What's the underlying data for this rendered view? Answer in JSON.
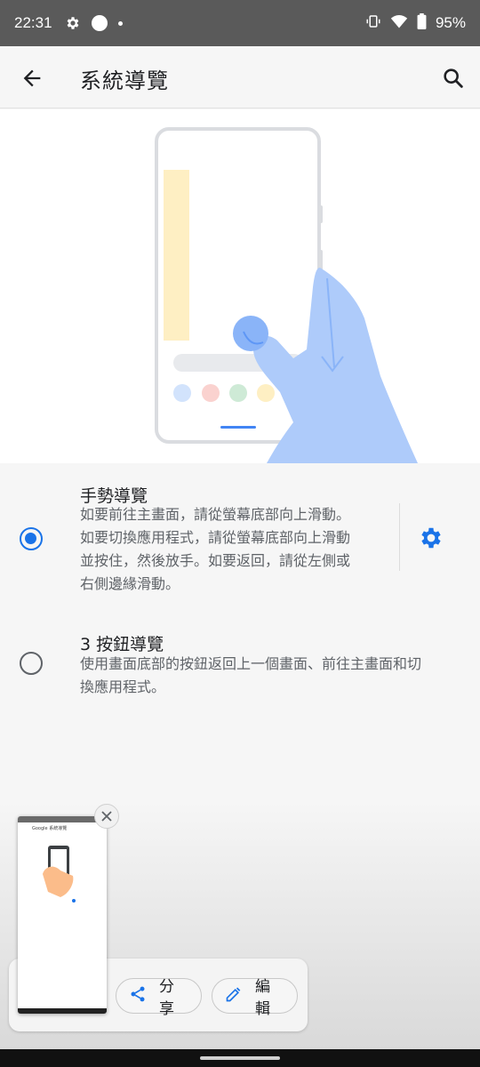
{
  "status_bar": {
    "time": "22:31",
    "battery": "95%"
  },
  "app_bar": {
    "title": "系統導覽"
  },
  "options": [
    {
      "title": "手勢導覽",
      "description_lines": [
        "如要前往主畫面，請從螢幕底部向上滑動。",
        "如要切換應用程式，請從螢幕底部向上滑動",
        "並按住，然後放手。如要返回，請從左側或",
        "右側邊緣滑動。"
      ],
      "selected": true
    },
    {
      "title": "3 按鈕導覽",
      "description_lines": [
        "使用畫面底部的按鈕返回上一個畫面、前往主畫面和切",
        "換應用程式。"
      ],
      "selected": false
    }
  ],
  "screenshot_preview": {
    "title": "Google 系統導覽"
  },
  "actions": {
    "share": "分享",
    "edit": "編輯"
  },
  "colors": {
    "accent": "#1a73e8",
    "illustration_blue": "#aecbfa",
    "illustration_yellow": "#feefc3",
    "status_bar": "#5a5a5a"
  },
  "icons": {
    "back": "arrow-left-icon",
    "search": "search-icon",
    "settings": "gear-icon",
    "share": "share-icon",
    "edit": "pencil-icon",
    "close": "close-icon"
  }
}
